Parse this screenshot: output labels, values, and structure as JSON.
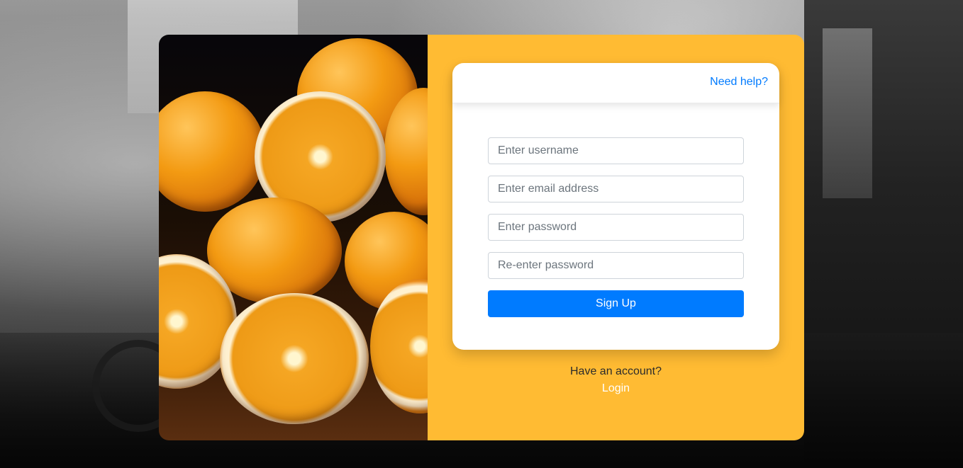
{
  "help": {
    "label": "Need help?"
  },
  "form": {
    "username_placeholder": "Enter username",
    "email_placeholder": "Enter email address",
    "password_placeholder": "Enter password",
    "confirm_placeholder": "Re-enter password",
    "submit_label": "Sign Up"
  },
  "footer": {
    "account_text": "Have an account?",
    "login_label": "Login"
  },
  "colors": {
    "panel": "#ffbb33",
    "primary": "#007bff",
    "card": "#ffffff"
  }
}
